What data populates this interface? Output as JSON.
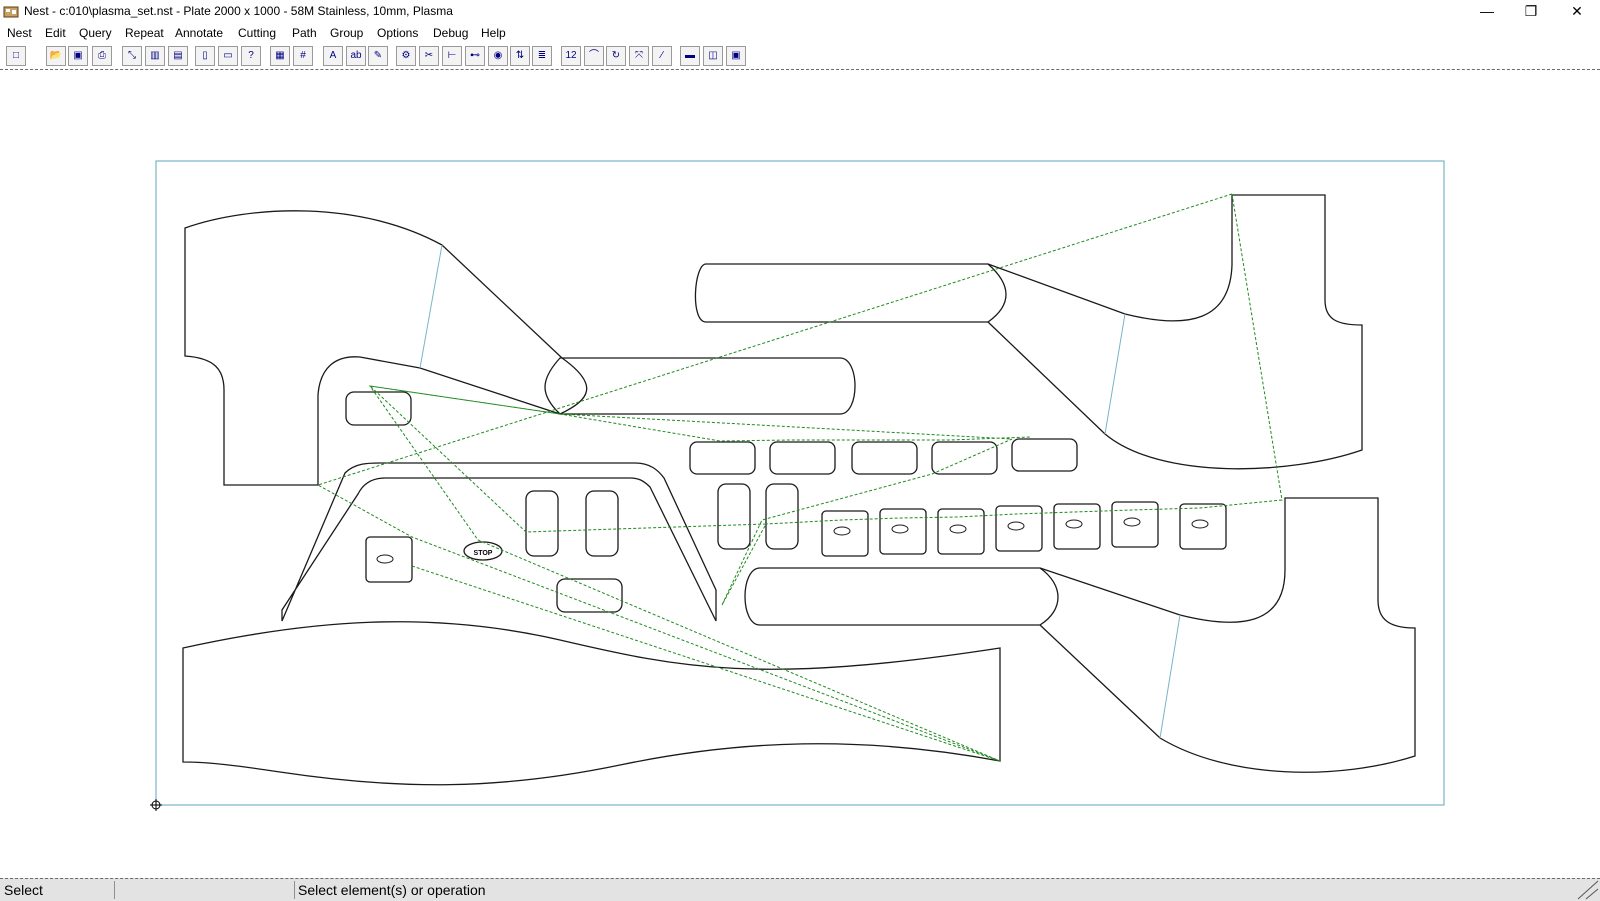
{
  "window": {
    "title": "Nest - c:010\\plasma_set.nst  - Plate 2000 x 1000 - 58M Stainless, 10mm, Plasma",
    "minimize": "—",
    "restore": "❐",
    "close": "✕"
  },
  "menu": [
    "Nest",
    "Edit",
    "Query",
    "Repeat",
    "Annotate",
    "Cutting",
    "Path",
    "Group",
    "Options",
    "Debug",
    "Help"
  ],
  "toolbar": {
    "buttons": [
      {
        "name": "new-icon",
        "glyph": "□"
      },
      {
        "name": "open-icon",
        "glyph": "📂"
      },
      {
        "name": "save-icon",
        "glyph": "▣"
      },
      {
        "name": "print-icon",
        "glyph": "⎙"
      },
      {
        "name": "zoom-extents-icon",
        "glyph": "⤡"
      },
      {
        "name": "view-plate-icon",
        "glyph": "▥"
      },
      {
        "name": "view-page-icon",
        "glyph": "▤"
      },
      {
        "name": "part-single-icon",
        "glyph": "▯"
      },
      {
        "name": "part-stack-icon",
        "glyph": "▭"
      },
      {
        "name": "help-icon",
        "glyph": "?"
      },
      {
        "name": "grid-small-icon",
        "glyph": "▦"
      },
      {
        "name": "grid-icon",
        "glyph": "#"
      },
      {
        "name": "text-icon",
        "glyph": "A"
      },
      {
        "name": "label-icon",
        "glyph": "ab"
      },
      {
        "name": "note-icon",
        "glyph": "✎"
      },
      {
        "name": "tool-path-icon",
        "glyph": "⚙"
      },
      {
        "name": "cut-settings-icon",
        "glyph": "✂"
      },
      {
        "name": "lead-icon",
        "glyph": "⊢"
      },
      {
        "name": "link-icon",
        "glyph": "⊷"
      },
      {
        "name": "pierce-icon",
        "glyph": "◉"
      },
      {
        "name": "sequence-icon",
        "glyph": "⇅"
      },
      {
        "name": "report-icon",
        "glyph": "≣"
      },
      {
        "name": "numbering-icon",
        "glyph": "12"
      },
      {
        "name": "measure-icon",
        "glyph": "⌒"
      },
      {
        "name": "rotate-icon",
        "glyph": "↻"
      },
      {
        "name": "mirror-icon",
        "glyph": "⤧"
      },
      {
        "name": "line-icon",
        "glyph": "∕"
      },
      {
        "name": "machine-icon",
        "glyph": "▬"
      },
      {
        "name": "simulate-icon",
        "glyph": "◫"
      },
      {
        "name": "display-icon",
        "glyph": "▣"
      }
    ]
  },
  "plate": {
    "width_mm": 2000,
    "height_mm": 1000,
    "material": "58M Stainless, 10mm",
    "process": "Plasma",
    "outline_color": "#7ab4c8",
    "part_color": "#1a1a1a",
    "path_color": "#1f8a1f",
    "stop_label": "STOP"
  },
  "status": {
    "mode": "Select",
    "middle": "",
    "message": "Select element(s) or operation"
  }
}
